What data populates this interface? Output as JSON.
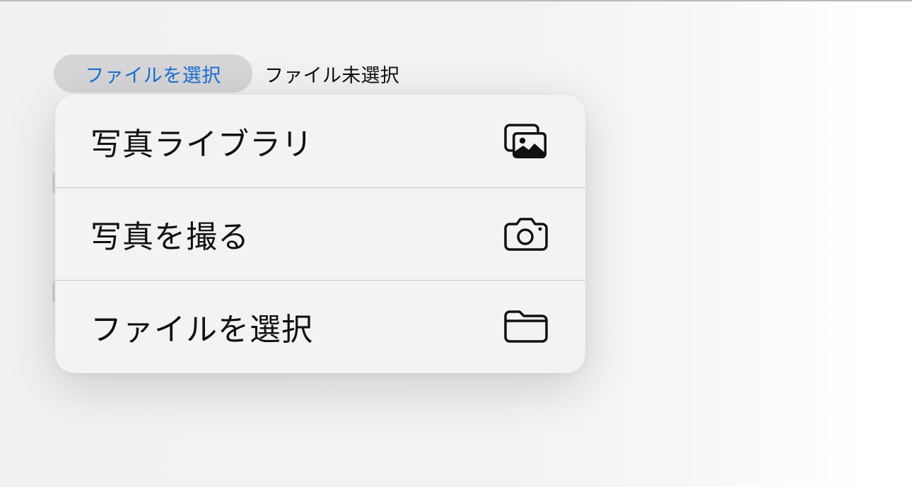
{
  "file_input": {
    "button_label": "ファイルを選択",
    "status_text": "ファイル未選択"
  },
  "menu": {
    "items": [
      {
        "label": "写真ライブラリ",
        "icon": "photo-library-icon"
      },
      {
        "label": "写真を撮る",
        "icon": "camera-icon"
      },
      {
        "label": "ファイルを選択",
        "icon": "folder-icon"
      }
    ]
  },
  "colors": {
    "link_blue": "#1a6fd2",
    "button_bg": "#d6d6d8",
    "menu_bg": "#f2f3f4"
  }
}
